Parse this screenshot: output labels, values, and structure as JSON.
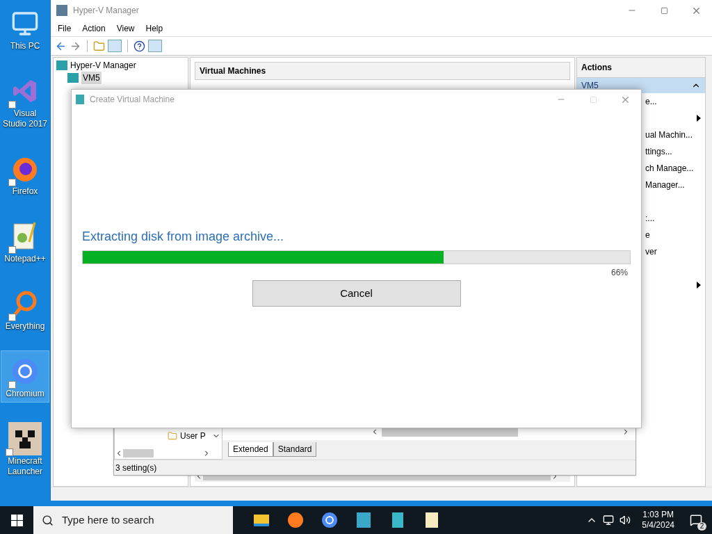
{
  "desktop_icons": [
    {
      "label": "This PC",
      "kind": "pc",
      "shortcut": false,
      "selected": false
    },
    {
      "label": "Visual Studio 2017",
      "kind": "vs",
      "shortcut": true,
      "selected": false
    },
    {
      "label": "Firefox",
      "kind": "firefox",
      "shortcut": true,
      "selected": false
    },
    {
      "label": "Notepad++",
      "kind": "notepad",
      "shortcut": true,
      "selected": false
    },
    {
      "label": "Everything",
      "kind": "everything",
      "shortcut": true,
      "selected": false
    },
    {
      "label": "Chromium",
      "kind": "chromium",
      "shortcut": true,
      "selected": true
    },
    {
      "label": "Minecraft Launcher",
      "kind": "minecraft",
      "shortcut": true,
      "selected": false
    }
  ],
  "window": {
    "title": "Hyper-V Manager",
    "menu": [
      "File",
      "Action",
      "View",
      "Help"
    ],
    "tree": {
      "label": "Hyper-V Manager",
      "children": [
        {
          "label": "VM5",
          "selected": true
        }
      ]
    },
    "center_header": "Virtual Machines",
    "actions": {
      "title": "Actions",
      "group": "VM5",
      "items": [
        {
          "label": "e...",
          "submenu": false
        },
        {
          "submenu": true
        },
        {
          "label": "ual Machin...",
          "submenu": false
        },
        {
          "label": "ttings...",
          "submenu": false
        },
        {
          "label": "ch Manage...",
          "submenu": false
        },
        {
          "label": "Manager...",
          "submenu": false
        },
        {
          "submenu": false
        },
        {
          "label": ":...",
          "submenu": false
        },
        {
          "label": "e",
          "submenu": false
        },
        {
          "label": "ver",
          "submenu": false
        },
        {
          "submenu": false
        },
        {
          "submenu": true
        }
      ]
    }
  },
  "settings_window": {
    "tree_item": "User P",
    "tabs": [
      {
        "label": "Extended",
        "selected": true
      },
      {
        "label": "Standard",
        "selected": false
      }
    ],
    "status": "3 setting(s)"
  },
  "dialog": {
    "title": "Create Virtual Machine",
    "message": "Extracting disk from image archive...",
    "progress": {
      "level": 0.66,
      "reading": "66%"
    },
    "button": "Cancel"
  },
  "taskbar": {
    "search_placeholder": "Type here to search",
    "pinned": [
      {
        "kind": "explorer"
      },
      {
        "kind": "firefox"
      },
      {
        "kind": "chromium"
      },
      {
        "kind": "hyperv"
      },
      {
        "kind": "hyperv2"
      },
      {
        "kind": "notepad"
      }
    ],
    "time": "1:03 PM",
    "date": "5/4/2024",
    "notifications": "2"
  }
}
